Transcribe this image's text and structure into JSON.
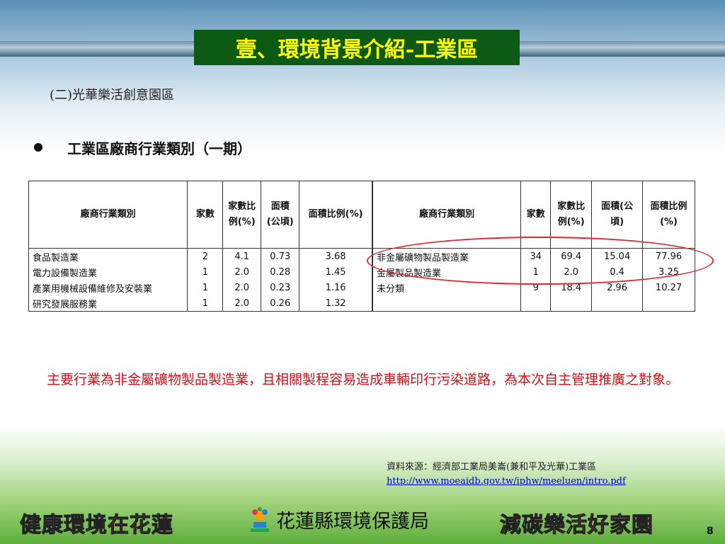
{
  "header": {
    "title": "壹、環境背景介紹-工業區"
  },
  "subtitle": "(二)光華樂活創意園區",
  "section_heading": "工業區廠商行業類別（一期）",
  "table": {
    "headers": [
      "廠商行業類別",
      "家數",
      "家數比例(%)",
      "面積(公頃)",
      "面積比例(%)"
    ],
    "left_rows": [
      [
        "食品製造業",
        "2",
        "4.1",
        "0.73",
        "3.68"
      ],
      [
        "電力設備製造業",
        "1",
        "2.0",
        "0.28",
        "1.45"
      ],
      [
        "產業用機械設備維修及安裝業",
        "1",
        "2.0",
        "0.23",
        "1.16"
      ],
      [
        "研究發展服務業",
        "1",
        "2.0",
        "0.26",
        "1.32"
      ]
    ],
    "right_rows": [
      [
        "非金屬礦物製品製造業",
        "34",
        "69.4",
        "15.04",
        "77.96"
      ],
      [
        "金屬製品製造業",
        "1",
        "2.0",
        "0.4",
        "3.25"
      ],
      [
        "未分類",
        "9",
        "18.4",
        "2.96",
        "10.27"
      ]
    ]
  },
  "note": "主要行業為非金屬礦物製品製造業，且相關製程容易造成車輛印行污染道路，為本次自主管理推廣之對象。",
  "source": {
    "label": "資料來源：經濟部工業局美崙(兼和平及光華)工業區",
    "url": "http://www.moeaidb.gov.tw/iphw/meeluen/intro.pdf"
  },
  "footer": {
    "slogan_left": [
      "健康",
      "環境",
      "在花蓮"
    ],
    "agency": "花蓮縣環境保護局",
    "slogan_right": [
      "減碳",
      "樂活",
      "好家園"
    ],
    "page_number": "8"
  },
  "colors": {
    "title_bg": "#0c5a14",
    "title_text": "#ffff00",
    "note": "#d0111a",
    "highlight": "#e0262e"
  }
}
